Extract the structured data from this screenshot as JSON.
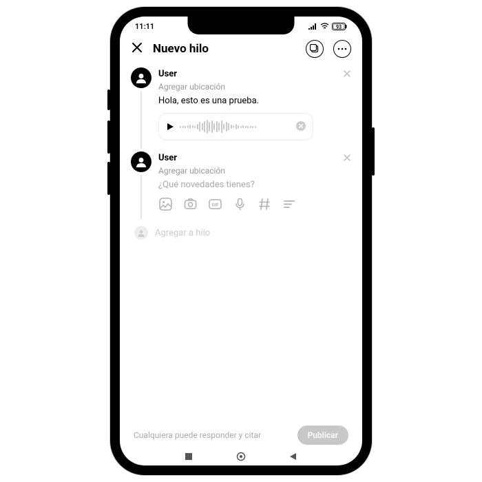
{
  "status": {
    "time": "11:11",
    "battery": "93"
  },
  "header": {
    "title": "Nuevo hilo"
  },
  "posts": [
    {
      "user": "User",
      "location": "Agregar ubicación",
      "text": "Hola, esto es una prueba.",
      "voice": true
    },
    {
      "user": "User",
      "location": "Agregar ubicación",
      "placeholder": "¿Qué novedades tienes?",
      "composer": true
    }
  ],
  "add_thread": "Agregar a hilo",
  "footer": {
    "note": "Cualquiera puede responder y citar",
    "publish": "Publicar"
  }
}
